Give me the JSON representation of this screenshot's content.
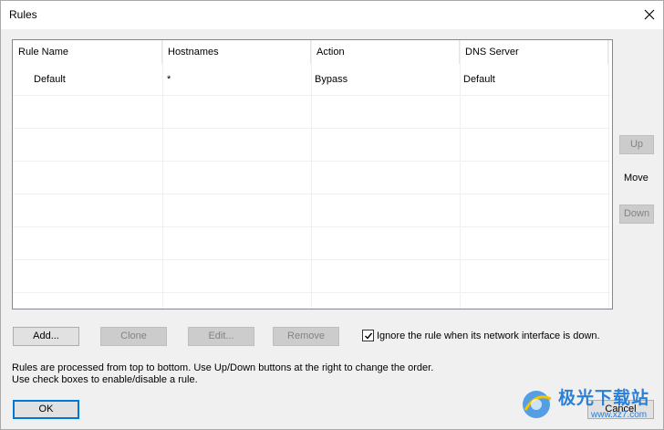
{
  "window": {
    "title": "Rules"
  },
  "table": {
    "columns": [
      "Rule Name",
      "Hostnames",
      "Action",
      "DNS Server"
    ],
    "rows": [
      {
        "rule_name": "Default",
        "hostnames": "*",
        "action": "Bypass",
        "dns_server": "Default"
      }
    ]
  },
  "side": {
    "up_label": "Up",
    "move_label": "Move",
    "down_label": "Down"
  },
  "actions": {
    "add_label": "Add...",
    "clone_label": "Clone",
    "edit_label": "Edit...",
    "remove_label": "Remove"
  },
  "ignore_checkbox": {
    "label": "Ignore the rule when its network interface is down.",
    "checked": true
  },
  "notes": {
    "line1": "Rules are processed from top to bottom. Use Up/Down buttons at the right to change the order.",
    "line2": "Use check boxes to enable/disable a rule."
  },
  "footer": {
    "ok_label": "OK",
    "cancel_label": "Cancel"
  },
  "watermark": {
    "brand": "极光下载站",
    "url": "www.xz7.com"
  }
}
